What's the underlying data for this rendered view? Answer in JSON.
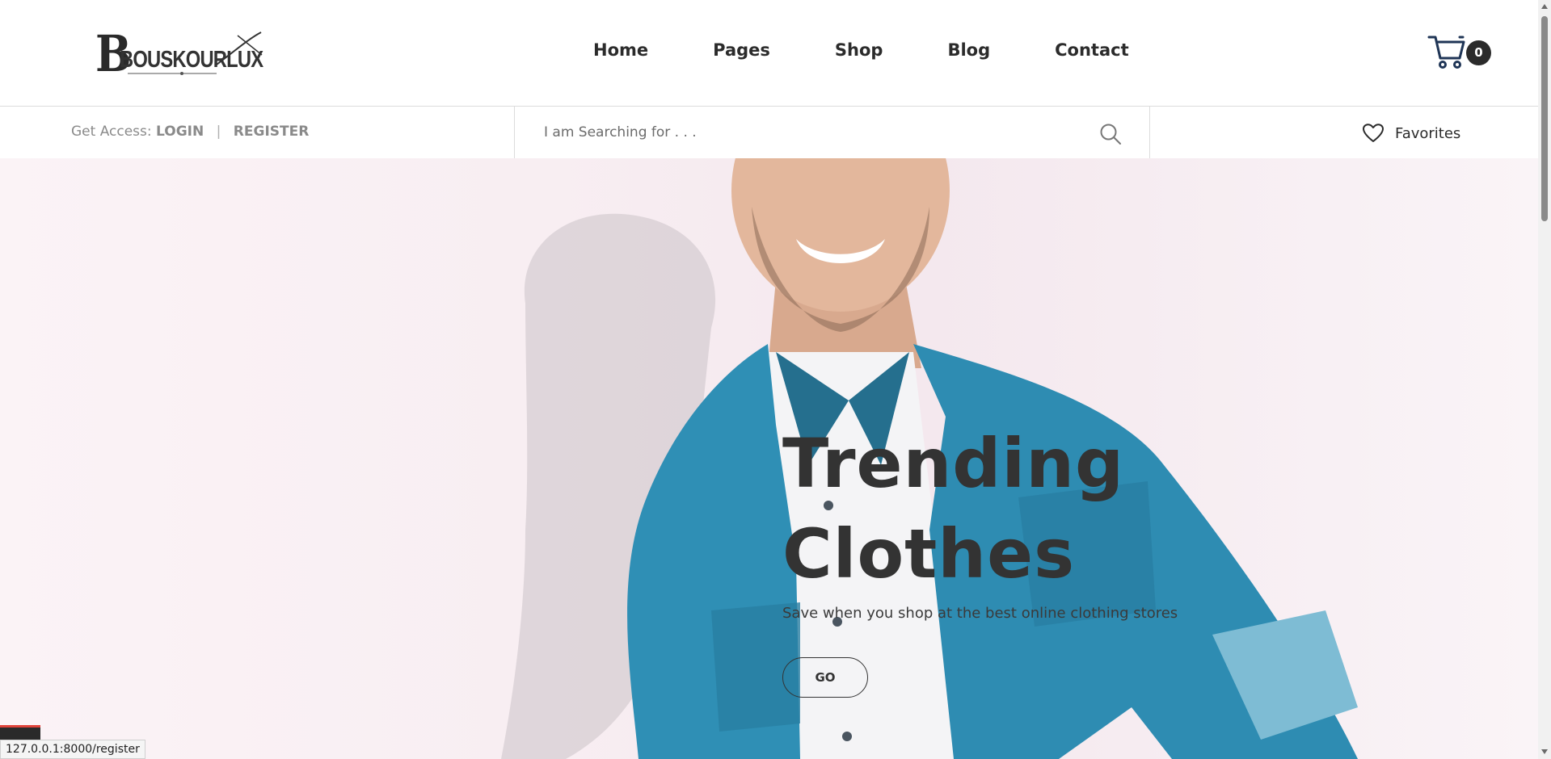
{
  "brand": {
    "logo_text": "BOUSKOURLUX",
    "logo_initial": "B"
  },
  "nav": {
    "items": [
      {
        "label": "Home"
      },
      {
        "label": "Pages"
      },
      {
        "label": "Shop"
      },
      {
        "label": "Blog"
      },
      {
        "label": "Contact"
      }
    ]
  },
  "cart": {
    "count": "0",
    "icon": "cart-icon"
  },
  "access": {
    "prefix": "Get Access:",
    "login_label": "LOGIN",
    "separator": "|",
    "register_label": "REGISTER"
  },
  "search": {
    "placeholder": "I am Searching for . . .",
    "value": "",
    "icon": "search-icon"
  },
  "favorites": {
    "label": "Favorites",
    "icon": "heart-icon"
  },
  "hero": {
    "title": "Trending Clothes",
    "subtitle": "Save when you shop at the best online clothing stores",
    "button_label": "GO"
  },
  "status_bar": {
    "url": "127.0.0.1:8000/register"
  },
  "colors": {
    "text_dark": "#2b2b2b",
    "text_muted": "#8a8a8a",
    "denim": "#2f8fb5",
    "hero_bg": "#f8eef2"
  }
}
